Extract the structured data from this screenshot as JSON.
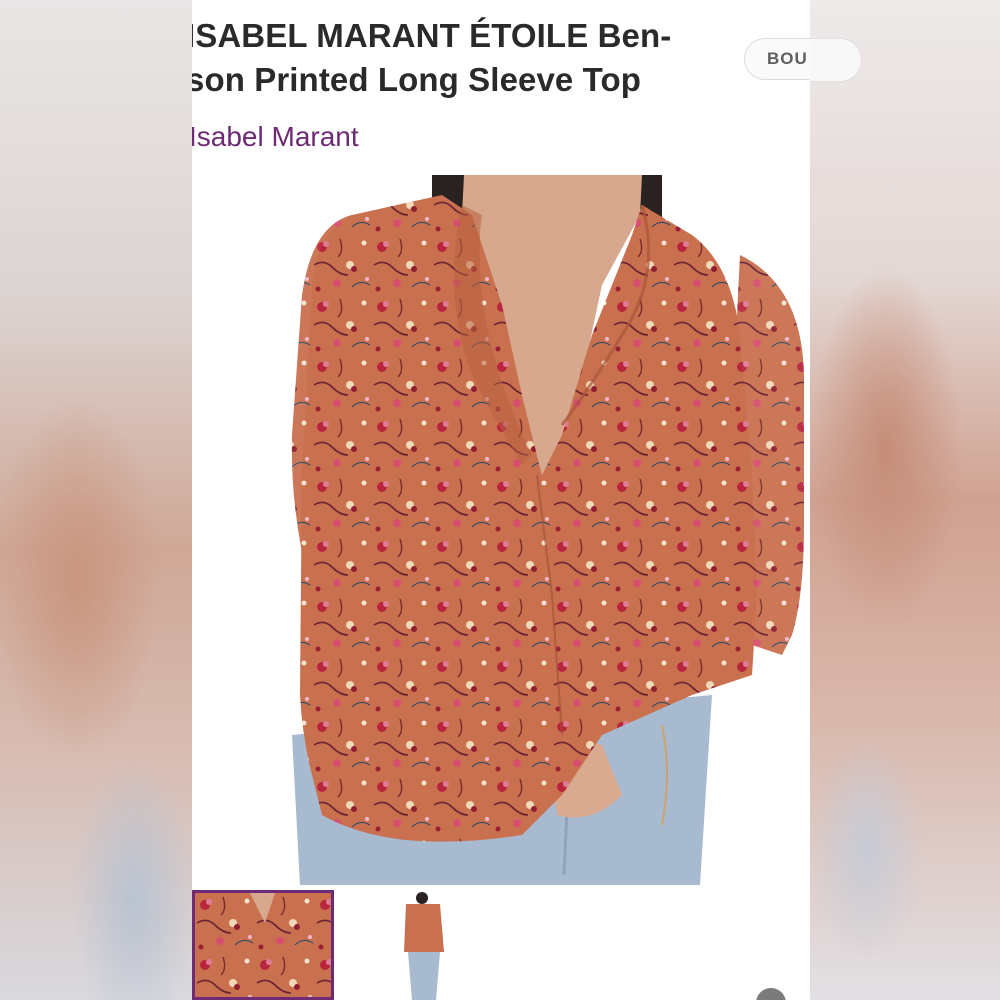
{
  "product": {
    "title": "ISABEL MARANT ÉTOILE Ben- son Printed Long Sleeve Top",
    "brand": "Isabel Marant",
    "action_button_label": "BOU"
  },
  "image": {
    "description_icon": "product-photo",
    "blouse_color": "#c9704f",
    "jeans_color": "#a8bad0"
  },
  "thumbnails": [
    {
      "label": "thumbnail-1",
      "selected": true
    },
    {
      "label": "thumbnail-2",
      "selected": false
    }
  ],
  "colors": {
    "brand": "#6e2a74",
    "title": "#2a2a2a",
    "background": "#ffffff"
  }
}
